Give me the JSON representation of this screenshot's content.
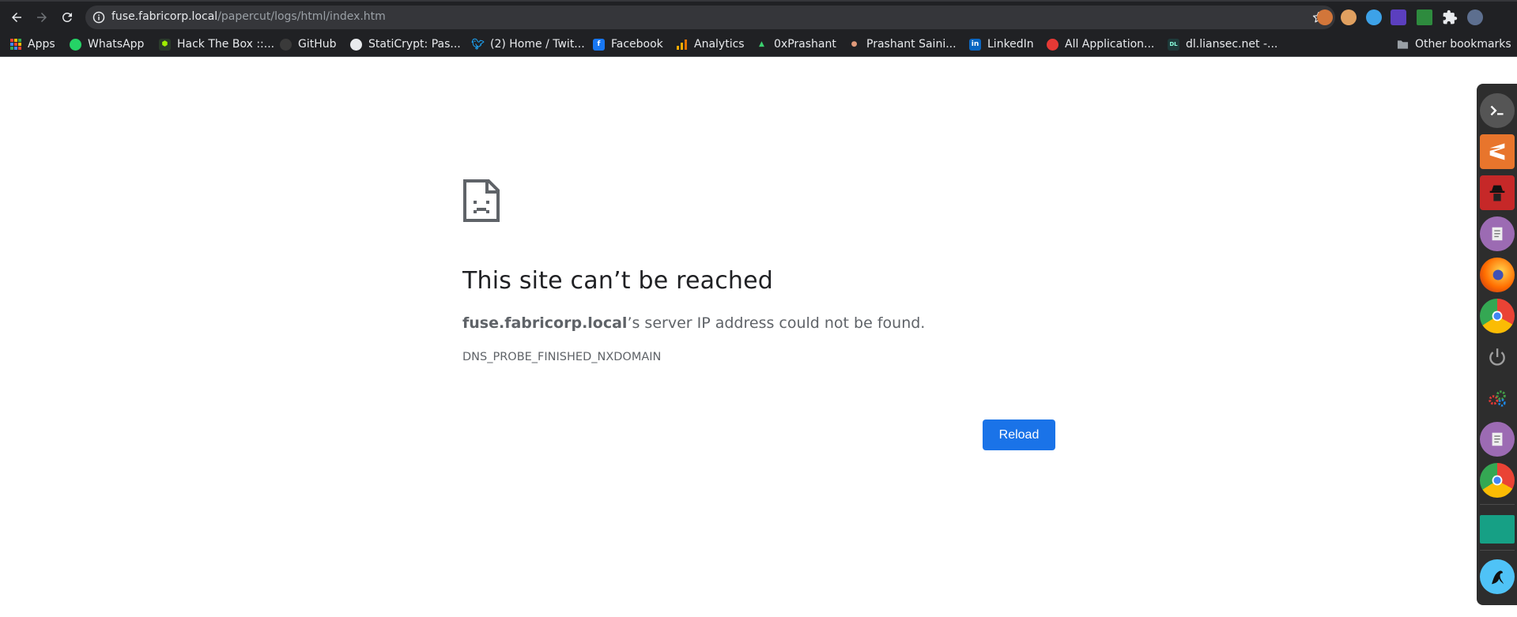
{
  "browser": {
    "url_host": "fuse.fabricorp.local",
    "url_path": "/papercut/logs/html/index.htm",
    "nav_icons": [
      "back-arrow-icon",
      "forward-arrow-icon",
      "reload-icon"
    ],
    "extension_icons": [
      "cookie-icon",
      "cookie-2-icon",
      "blue-circle-icon",
      "purple-cube-icon",
      "green-terminal-icon",
      "puzzle-icon",
      "profile-icon"
    ]
  },
  "bookmarks": {
    "items": [
      {
        "label": "Apps",
        "icon": "apps-grid-icon"
      },
      {
        "label": "WhatsApp",
        "icon": "whatsapp-icon"
      },
      {
        "label": "Hack The Box ::...",
        "icon": "hackthebox-icon"
      },
      {
        "label": "GitHub",
        "icon": "github-icon"
      },
      {
        "label": "StatiCrypt: Pas...",
        "icon": "globe-icon"
      },
      {
        "label": "(2) Home / Twit...",
        "icon": "twitter-icon"
      },
      {
        "label": "Facebook",
        "icon": "facebook-icon"
      },
      {
        "label": "Analytics",
        "icon": "analytics-icon"
      },
      {
        "label": "0xPrashant",
        "icon": "0xprashant-icon"
      },
      {
        "label": "Prashant Saini...",
        "icon": "prashant-icon"
      },
      {
        "label": "LinkedIn",
        "icon": "linkedin-icon"
      },
      {
        "label": "All Application...",
        "icon": "app-icon"
      },
      {
        "label": "dl.liansec.net -...",
        "icon": "dl-icon"
      }
    ],
    "other_label": "Other bookmarks"
  },
  "error": {
    "title": "This site can’t be reached",
    "host": "fuse.fabricorp.local",
    "message_rest": "’s server IP address could not be found.",
    "code": "DNS_PROBE_FINISHED_NXDOMAIN",
    "reload_label": "Reload"
  },
  "colors": {
    "chrome_bg": "#202124",
    "omnibox_bg": "#35363a",
    "button_blue": "#1a73e8",
    "title_text": "#202124",
    "body_text": "#5f6368"
  },
  "dock": {
    "icons": [
      "terminal-icon",
      "sublime-icon",
      "john-ripper-icon",
      "text-editor-icon",
      "firefox-icon",
      "chrome-icon",
      "power-icon",
      "settings-icon",
      "text-editor-2-icon",
      "chrome-2-icon",
      "green-window-icon",
      "kali-icon"
    ]
  }
}
